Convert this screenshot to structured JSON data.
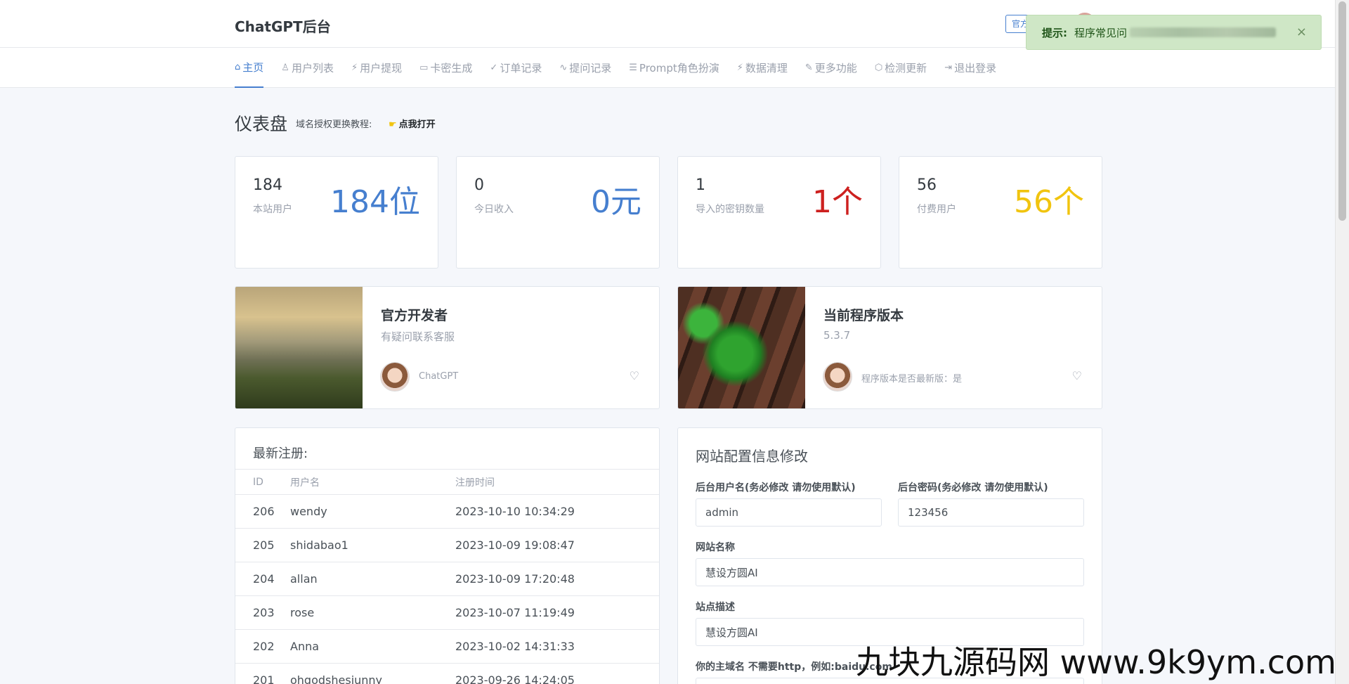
{
  "brand": "ChatGPT后台",
  "top_button": "官方",
  "toast": {
    "title": "提示:",
    "message": "程序常见问",
    "close": "×"
  },
  "nav": [
    {
      "icon": "⌂",
      "label": "主页",
      "active": true
    },
    {
      "icon": "♙",
      "label": "用户列表"
    },
    {
      "icon": "⚡",
      "label": "用户提现"
    },
    {
      "icon": "▭",
      "label": "卡密生成"
    },
    {
      "icon": "✓",
      "label": "订单记录"
    },
    {
      "icon": "∿",
      "label": "提问记录"
    },
    {
      "icon": "☰",
      "label": "Prompt角色扮演"
    },
    {
      "icon": "⚡",
      "label": "数据清理"
    },
    {
      "icon": "✎",
      "label": "更多功能"
    },
    {
      "icon": "⬡",
      "label": "检测更新"
    },
    {
      "icon": "⇥",
      "label": "退出登录"
    }
  ],
  "page": {
    "title": "仪表盘",
    "subtitle": "域名授权更换教程:",
    "link": "点我打开"
  },
  "stats": [
    {
      "value": "184",
      "label": "本站用户",
      "big": "184位",
      "color": "#467fcf"
    },
    {
      "value": "0",
      "label": "今日收入",
      "big": "0元",
      "color": "#467fcf"
    },
    {
      "value": "1",
      "label": "导入的密钥数量",
      "big": "1个",
      "color": "#cd201f"
    },
    {
      "value": "56",
      "label": "付费用户",
      "big": "56个",
      "color": "#f1c40f"
    }
  ],
  "media": [
    {
      "title": "官方开发者",
      "sub": "有疑问联系客服",
      "author": "ChatGPT"
    },
    {
      "title": "当前程序版本",
      "sub": "5.3.7",
      "author": "程序版本是否最新版：是"
    }
  ],
  "registrations": {
    "title": "最新注册:",
    "headers": [
      "ID",
      "用户名",
      "注册时间"
    ],
    "rows": [
      [
        "206",
        "wendy",
        "2023-10-10 10:34:29"
      ],
      [
        "205",
        "shidabao1",
        "2023-10-09 19:08:47"
      ],
      [
        "204",
        "allan",
        "2023-10-09 17:20:48"
      ],
      [
        "203",
        "rose",
        "2023-10-07 11:19:49"
      ],
      [
        "202",
        "Anna",
        "2023-10-02 14:31:33"
      ],
      [
        "201",
        "ohgodshesiunny",
        "2023-09-26 14:24:05"
      ]
    ]
  },
  "config": {
    "title": "网站配置信息修改",
    "admin_user_label": "后台用户名(务必修改 请勿使用默认)",
    "admin_user_value": "admin",
    "admin_pass_label": "后台密码(务必修改 请勿使用默认)",
    "admin_pass_value": "123456",
    "site_name_label": "网站名称",
    "site_name_value": "慧设方圆AI",
    "site_desc_label": "站点描述",
    "site_desc_value": "慧设方圆AI",
    "domain_label": "你的主域名 不需要http，例如:baidu.com"
  },
  "watermark": "九块九源码网 www.9k9ym.com"
}
